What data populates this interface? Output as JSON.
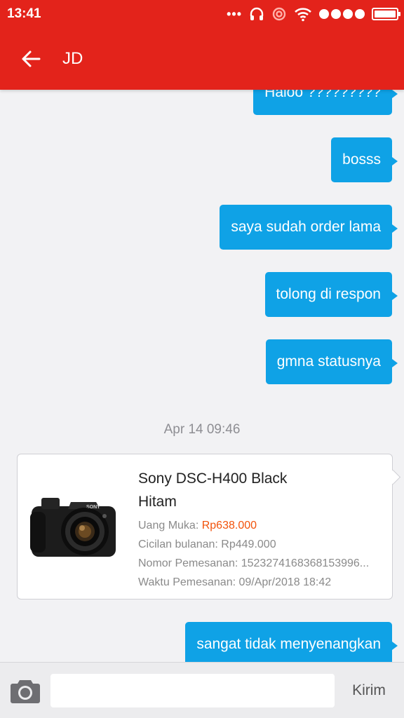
{
  "status_bar": {
    "time": "13:41",
    "icons": [
      "more-dots-icon",
      "headset-icon",
      "hotspot-icon",
      "wifi-icon",
      "signal-dots-icon",
      "battery-icon"
    ]
  },
  "header": {
    "title": "JD",
    "back_icon": "arrow-left-icon",
    "background_color": "#e3231b"
  },
  "messages": [
    {
      "from": "me",
      "text": "Haloo ?????????"
    },
    {
      "from": "me",
      "text": "bosss"
    },
    {
      "from": "me",
      "text": "saya sudah order lama"
    },
    {
      "from": "me",
      "text": "tolong di respon"
    },
    {
      "from": "me",
      "text": "gmna statusnya"
    }
  ],
  "timestamp": "Apr 14 09:46",
  "order_card": {
    "product_name_line1": "Sony DSC-H400 Black",
    "product_name_line2": "Hitam",
    "down_payment_label": "Uang Muka: ",
    "down_payment_value": "Rp638.000",
    "installment": "Cicilan bulanan: Rp449.000",
    "order_number": "Nomor Pemesanan: 1523274168368153996...",
    "order_time": "Waktu Pemesanan: 09/Apr/2018 18:42",
    "image_icon": "camera-product-image",
    "price_color": "#f2520a"
  },
  "last_message": "sangat tidak menyenangkan",
  "input_bar": {
    "camera_icon": "camera-icon",
    "placeholder": "",
    "send_label": "Kirim"
  },
  "colors": {
    "bubble": "#0fa2e6",
    "background": "#f2f2f4"
  }
}
